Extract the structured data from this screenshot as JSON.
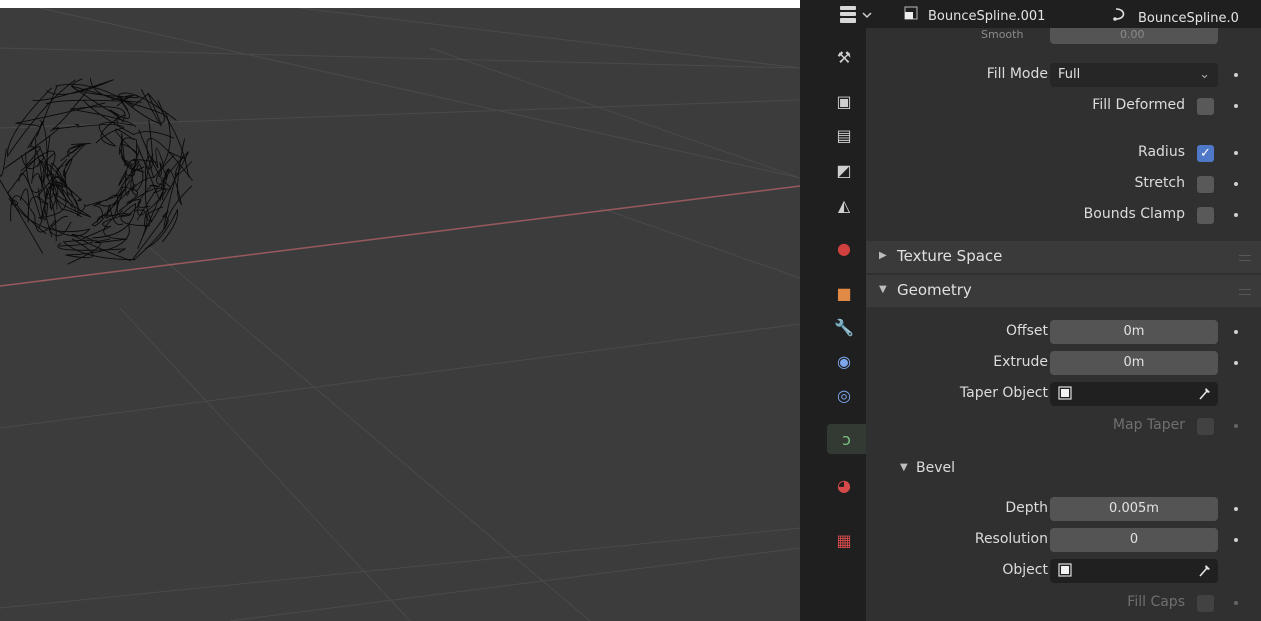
{
  "header": {
    "object_name": "BounceSpline.001",
    "data_name": "BounceSpline.0"
  },
  "tabs": [
    {
      "name": "tool-tab",
      "icon": "tool-icon"
    },
    {
      "name": "render-tab",
      "icon": "render-icon"
    },
    {
      "name": "output-tab",
      "icon": "output-icon"
    },
    {
      "name": "view-layer-tab",
      "icon": "view-layer-icon"
    },
    {
      "name": "scene-tab",
      "icon": "scene-icon"
    },
    {
      "name": "world-tab",
      "icon": "world-icon"
    },
    {
      "name": "object-tab",
      "icon": "object-icon"
    },
    {
      "name": "modifiers-tab",
      "icon": "wrench-icon"
    },
    {
      "name": "particles-tab",
      "icon": "particles-icon"
    },
    {
      "name": "physics-tab",
      "icon": "physics-icon"
    },
    {
      "name": "object-data-tab",
      "icon": "curve-data-icon"
    },
    {
      "name": "material-tab",
      "icon": "material-icon"
    },
    {
      "name": "texture-tab",
      "icon": "texture-icon"
    }
  ],
  "shape": {
    "smooth_label": "Smooth",
    "smooth_value": "0.00",
    "fill_mode_label": "Fill Mode",
    "fill_mode_value": "Full",
    "fill_deformed_label": "Fill Deformed",
    "fill_deformed_checked": false,
    "radius_label": "Radius",
    "radius_checked": true,
    "stretch_label": "Stretch",
    "stretch_checked": false,
    "bounds_clamp_label": "Bounds Clamp",
    "bounds_clamp_checked": false
  },
  "panels": {
    "texture_space": "Texture Space",
    "geometry": "Geometry",
    "bevel": "Bevel"
  },
  "geometry": {
    "offset_label": "Offset",
    "offset_value": "0m",
    "extrude_label": "Extrude",
    "extrude_value": "0m",
    "taper_object_label": "Taper Object",
    "map_taper_label": "Map Taper"
  },
  "bevel": {
    "depth_label": "Depth",
    "depth_value": "0.005m",
    "resolution_label": "Resolution",
    "resolution_value": "0",
    "object_label": "Object",
    "fill_caps_label": "Fill Caps"
  },
  "colors": {
    "viewport_bg": "#3c3c3c",
    "x_axis": "#9a5a5e",
    "checkbox_on": "#4f78c9",
    "active_tab": "#333a33"
  }
}
